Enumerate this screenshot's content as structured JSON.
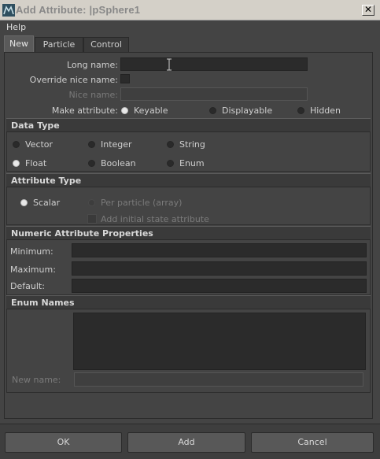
{
  "window": {
    "title": "Add Attribute: |pSphere1",
    "close_glyph": "✕"
  },
  "menu": {
    "help": "Help"
  },
  "tabs": [
    {
      "label": "New",
      "active": true
    },
    {
      "label": "Particle",
      "active": false
    },
    {
      "label": "Control",
      "active": false
    }
  ],
  "form": {
    "long_name_label": "Long name:",
    "long_name_value": "",
    "override_nice_label": "Override nice name:",
    "override_nice_checked": false,
    "nice_name_label": "Nice name:",
    "nice_name_value": "",
    "make_attribute_label": "Make attribute:",
    "make_attribute_options": [
      "Keyable",
      "Displayable",
      "Hidden"
    ],
    "make_attribute_selected": "Keyable"
  },
  "data_type": {
    "header": "Data Type",
    "options": [
      "Vector",
      "Integer",
      "String",
      "Float",
      "Boolean",
      "Enum"
    ],
    "selected": "Float"
  },
  "attribute_type": {
    "header": "Attribute Type",
    "options": [
      "Scalar",
      "Per particle (array)"
    ],
    "selected": "Scalar",
    "initial_state_label": "Add initial state attribute",
    "initial_state_checked": false
  },
  "numeric": {
    "header": "Numeric Attribute Properties",
    "minimum_label": "Minimum:",
    "minimum_value": "",
    "maximum_label": "Maximum:",
    "maximum_value": "",
    "default_label": "Default:",
    "default_value": ""
  },
  "enum": {
    "header": "Enum Names",
    "new_name_label": "New name:",
    "new_name_value": ""
  },
  "buttons": {
    "ok": "OK",
    "add": "Add",
    "cancel": "Cancel"
  },
  "colors": {
    "background": "#444444",
    "field": "#2b2b2b",
    "header": "#3a3a3a",
    "button": "#585858",
    "titlebar": "#d4d0c8",
    "radio_on": "#e8e8e8"
  },
  "icons": {
    "app": "maya-icon",
    "cursor": "text-cursor-icon"
  }
}
